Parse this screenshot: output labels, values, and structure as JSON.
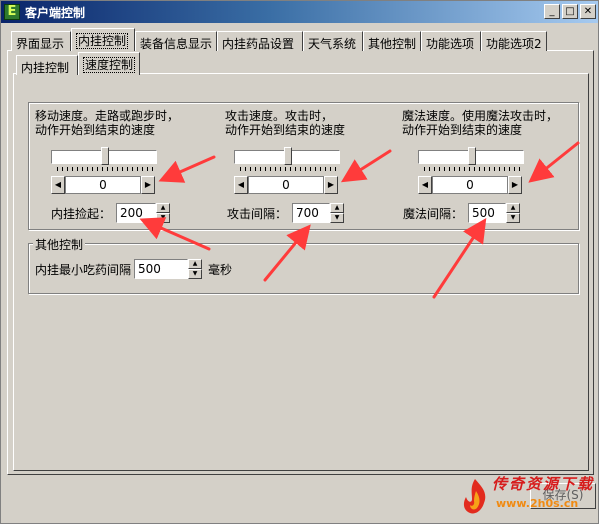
{
  "window": {
    "title": "客户端控制",
    "app_icon": "E",
    "controls": {
      "minimize": "_",
      "maximize": "□",
      "close": "✕"
    }
  },
  "main_tabs": [
    {
      "label": "界面显示"
    },
    {
      "label": "内挂控制"
    },
    {
      "label": "装备信息显示"
    },
    {
      "label": "内挂药品设置"
    },
    {
      "label": "天气系统"
    },
    {
      "label": "其他控制"
    },
    {
      "label": "功能选项"
    },
    {
      "label": "功能选项2"
    }
  ],
  "sub_tabs": [
    {
      "label": "内挂控制"
    },
    {
      "label": "速度控制"
    }
  ],
  "speed_group": {
    "columns": [
      {
        "desc_line1": "移动速度。走路或跑步时，",
        "desc_line2": "动作开始到结束的速度",
        "slider_position": 0.45,
        "scroll_value": "0",
        "field_label": "内挂捡起：",
        "field_value": "200"
      },
      {
        "desc_line1": "攻击速度。攻击时，",
        "desc_line2": "动作开始到结束的速度",
        "slider_position": 0.45,
        "scroll_value": "0",
        "field_label": "攻击间隔：",
        "field_value": "700"
      },
      {
        "desc_line1": "魔法速度。使用魔法攻击时，",
        "desc_line2": "动作开始到结束的速度",
        "slider_position": 0.45,
        "scroll_value": "0",
        "field_label": "魔法间隔：",
        "field_value": "500"
      }
    ]
  },
  "other_group": {
    "legend": "其他控制",
    "field_label": "内挂最小吃药间隔",
    "field_value": "500",
    "unit": "毫秒"
  },
  "save_button": {
    "label": "保存(S)"
  },
  "watermark": {
    "text": "传奇资源下载",
    "url": "www.2h0s.cn"
  },
  "colors": {
    "annotation_arrow": "#ff3b3b",
    "titlebar": "#0a246a"
  }
}
